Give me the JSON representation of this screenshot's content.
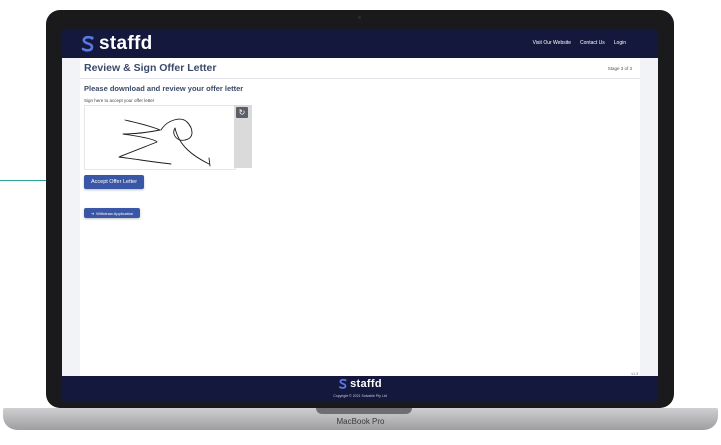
{
  "header": {
    "brand": "staffd",
    "links": [
      "Visit Our Website",
      "Contact Us",
      "Login"
    ]
  },
  "page": {
    "title": "Review & Sign Offer Letter",
    "stage": "Stage 3 of 3",
    "section_title": "Please download and review your offer letter",
    "sign_label": "Sign here to accept your offer letter"
  },
  "actions": {
    "accept_label": "Accept Offer Letter",
    "withdraw_label": "Withdraw Application"
  },
  "version": "v1.3",
  "footer": {
    "brand": "staffd",
    "copyright": "Copyright © 2021 Solvable Pty Ltd"
  },
  "device": {
    "label": "MacBook Pro"
  },
  "colors": {
    "navy": "#14183c",
    "button_blue": "#3a56a6",
    "brand_icon": "#5b78e0",
    "title_text": "#3b4a6b",
    "pointer": "#2aa39a"
  },
  "icons": [
    "staffd-logo-icon",
    "refresh-icon",
    "exit-icon"
  ]
}
